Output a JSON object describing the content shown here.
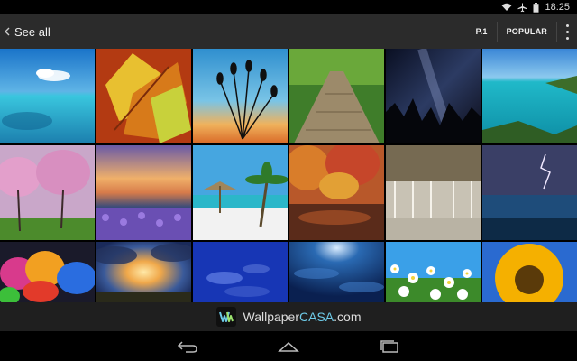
{
  "status": {
    "time": "18:25",
    "icons": [
      "wifi-icon",
      "airplane-icon",
      "battery-icon"
    ]
  },
  "appbar": {
    "back_label": "See all",
    "page_label": "P.1",
    "sort_label": "POPULAR",
    "menu_icon": "overflow-menu-icon"
  },
  "grid": {
    "columns": 6,
    "rows": 3,
    "items": [
      {
        "name": "tropical-lagoon"
      },
      {
        "name": "autumn-leaves"
      },
      {
        "name": "plant-silhouette-sunset"
      },
      {
        "name": "wooden-forest-path"
      },
      {
        "name": "night-sky-trees"
      },
      {
        "name": "turquoise-bay"
      },
      {
        "name": "pink-blossom-orchard"
      },
      {
        "name": "lavender-lake-sunset"
      },
      {
        "name": "beach-umbrella-palm"
      },
      {
        "name": "autumn-forest-reflection"
      },
      {
        "name": "waterfall"
      },
      {
        "name": "lightning-over-sea"
      },
      {
        "name": "colorful-flowers"
      },
      {
        "name": "sunburst-clouds"
      },
      {
        "name": "blue-cloud-sky"
      },
      {
        "name": "dark-blue-cloudscape"
      },
      {
        "name": "white-daisies"
      },
      {
        "name": "sunflower"
      }
    ]
  },
  "brand": {
    "name_prefix": "Wallpaper",
    "name_highlight": "CASA",
    "name_suffix": ".com"
  },
  "navbar": {
    "back": "nav-back-icon",
    "home": "nav-home-icon",
    "recents": "nav-recents-icon"
  }
}
